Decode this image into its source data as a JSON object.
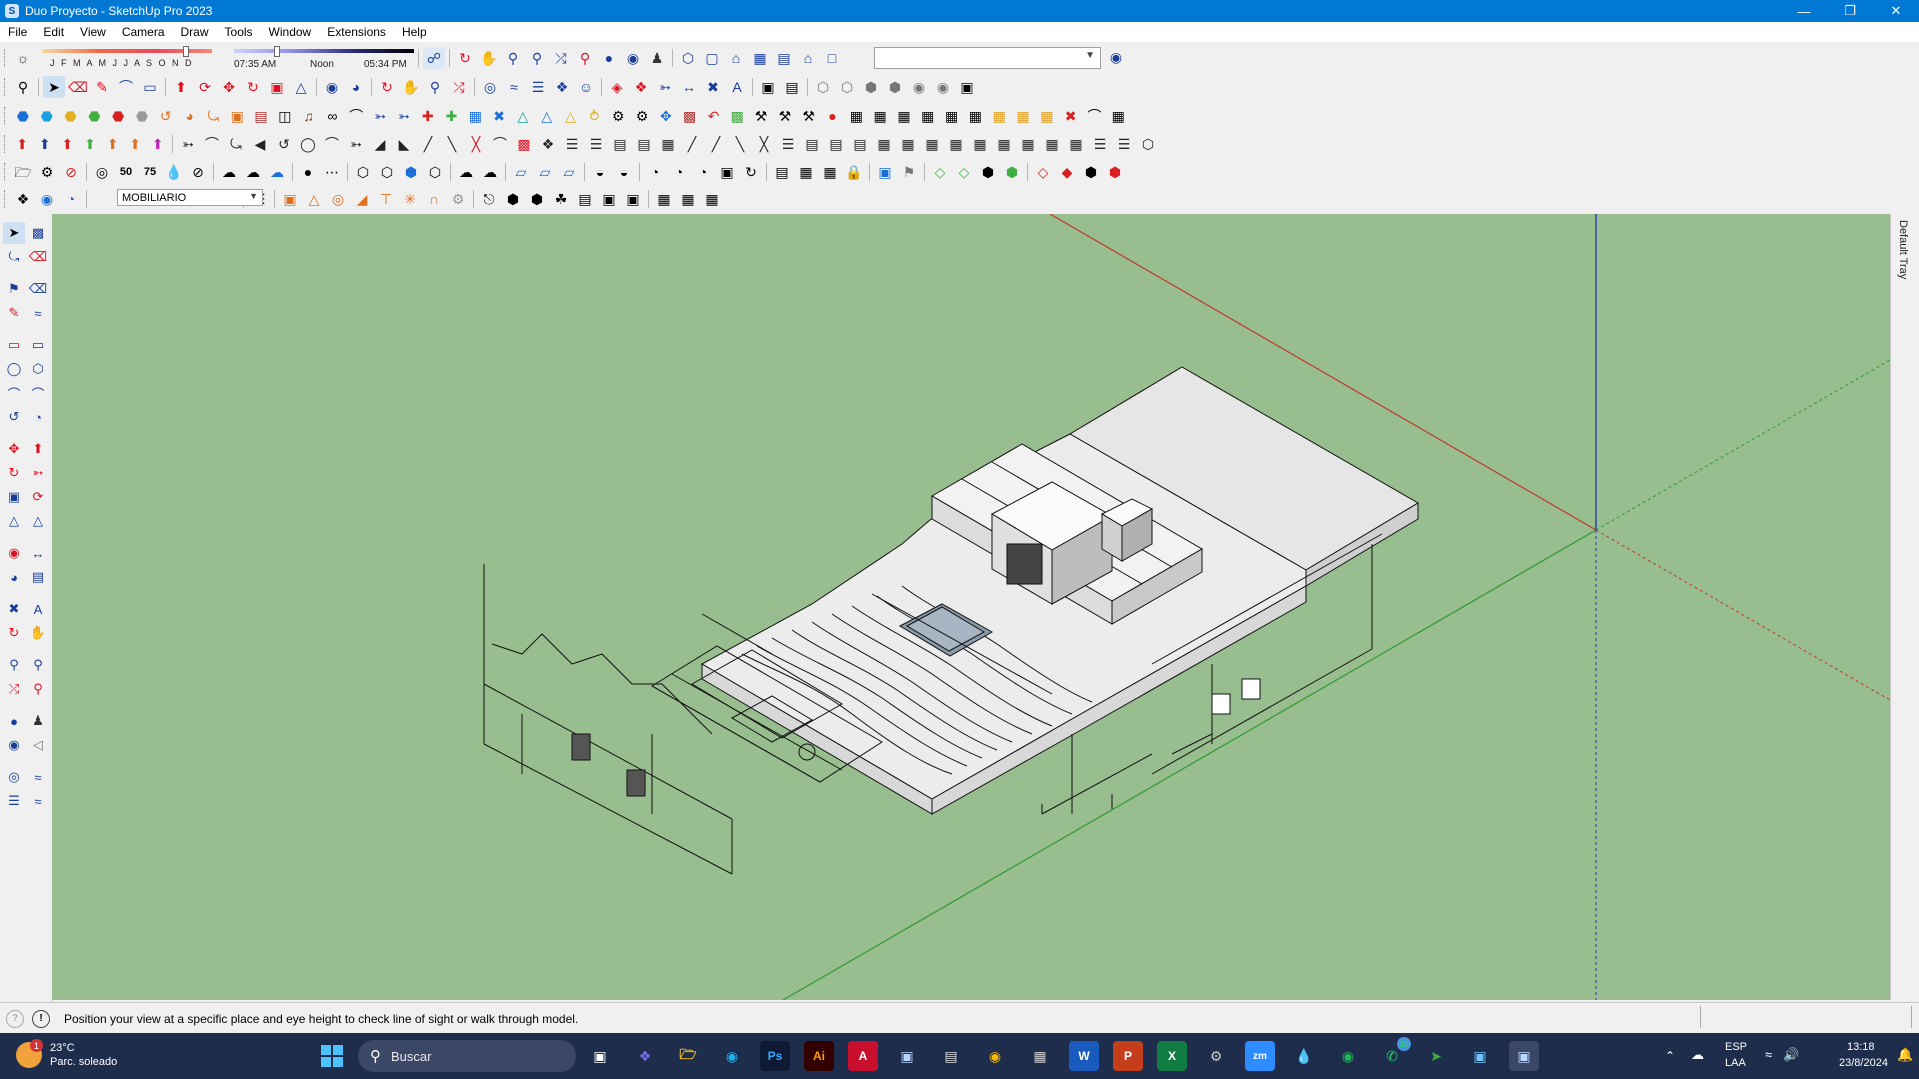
{
  "window": {
    "title": "Duo Proyecto - SketchUp Pro 2023",
    "min_icon": "minimize-icon",
    "restore_icon": "restore-icon",
    "close_icon": "close-icon"
  },
  "menu": [
    "File",
    "Edit",
    "View",
    "Camera",
    "Draw",
    "Tools",
    "Window",
    "Extensions",
    "Help"
  ],
  "shadows": {
    "months": "J F M A M J J A S O N D",
    "time_start": "07:35 AM",
    "time_noon": "Noon",
    "time_end": "05:34 PM"
  },
  "scenes_dropdown": {
    "value": ""
  },
  "tags": {
    "active_tag": "MOBILIARIO"
  },
  "tray": {
    "label": "Default Tray"
  },
  "status": {
    "message": "Position your view at a specific place and eye height to check line of sight or walk through model."
  },
  "taskbar": {
    "weather_temp": "23°C",
    "weather_desc": "Parc. soleado",
    "weather_badge": "1",
    "search_placeholder": "Buscar",
    "whatsapp_badge": "36",
    "lang_top": "ESP",
    "lang_bottom": "LAA",
    "time": "13:18",
    "date": "23/8/2024"
  },
  "colors": {
    "titlebar": "#0078d4",
    "viewport_bg": "#98bd8e",
    "taskbar": "#1f2d4d",
    "axis_red": "#c0392b",
    "axis_green": "#2e9a2e",
    "axis_blue": "#1f3fa8"
  }
}
